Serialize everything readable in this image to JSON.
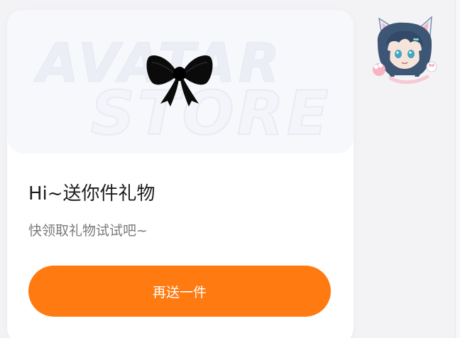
{
  "banner": {
    "watermark_line1": "AVATAR",
    "watermark_line2": "STORE",
    "bow_icon": "black-bow-icon"
  },
  "gift": {
    "title": "Hi~送你件礼物",
    "subtitle": "快领取礼物试试吧~",
    "button_label": "再送一件"
  },
  "avatar": {
    "icon": "anime-cat-girl-avatar"
  },
  "colors": {
    "accent": "#ff7a10",
    "card": "#ffffff",
    "background": "#f3f3f5"
  }
}
